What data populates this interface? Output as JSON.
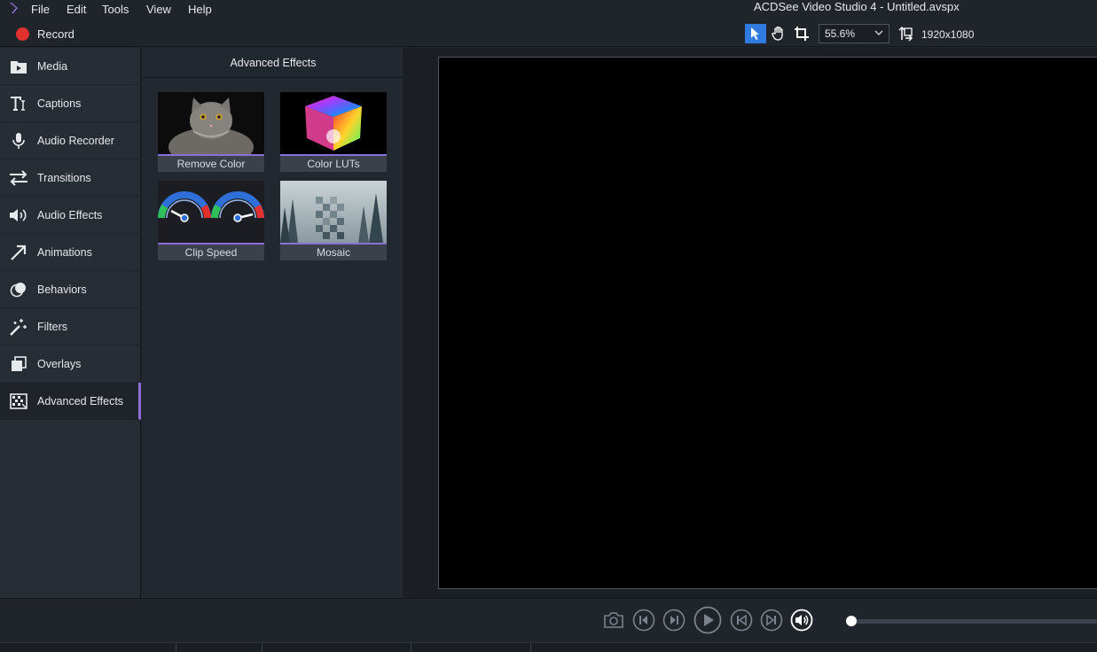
{
  "window": {
    "title": "ACDSee Video Studio 4 - Untitled.avspx"
  },
  "menu": [
    "File",
    "Edit",
    "Tools",
    "View",
    "Help"
  ],
  "record": {
    "label": "Record"
  },
  "toolbar": {
    "zoom": "55.6%",
    "resolution": "1920x1080",
    "tools": [
      "select-icon",
      "pan-hand-icon",
      "crop-icon"
    ]
  },
  "sidebar": {
    "items": [
      {
        "label": "Media",
        "icon": "media-folder-icon"
      },
      {
        "label": "Captions",
        "icon": "caption-text-icon"
      },
      {
        "label": "Audio Recorder",
        "icon": "microphone-icon"
      },
      {
        "label": "Transitions",
        "icon": "transition-arrows-icon"
      },
      {
        "label": "Audio Effects",
        "icon": "speaker-icon"
      },
      {
        "label": "Animations",
        "icon": "arrow-icon"
      },
      {
        "label": "Behaviors",
        "icon": "behaviors-icon"
      },
      {
        "label": "Filters",
        "icon": "magic-wand-icon"
      },
      {
        "label": "Overlays",
        "icon": "overlay-icon"
      },
      {
        "label": "Advanced Effects",
        "icon": "advanced-effects-icon"
      }
    ],
    "active": "Advanced Effects"
  },
  "panel": {
    "title": "Advanced Effects",
    "effects": [
      {
        "label": "Remove Color"
      },
      {
        "label": "Color LUTs"
      },
      {
        "label": "Clip Speed"
      },
      {
        "label": "Mosaic"
      }
    ]
  },
  "colors": {
    "accent": "#8b6fd6",
    "record": "#e0312e",
    "active_tool": "#2f7be1"
  }
}
